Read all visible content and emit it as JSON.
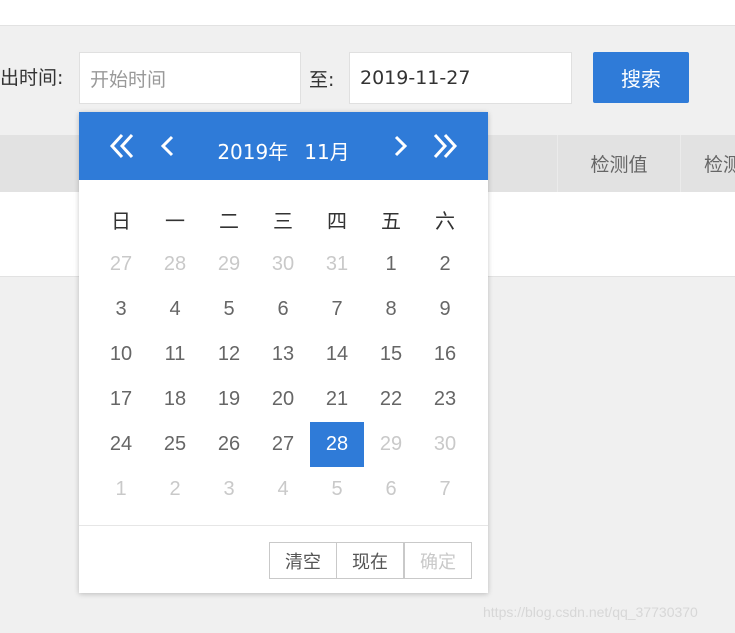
{
  "form": {
    "from_label": "出时间:",
    "start_placeholder": "开始时间",
    "to_label": "至:",
    "end_value": "2019-11-27",
    "search_label": "搜索"
  },
  "table": {
    "headers": [
      "检测值",
      "检测"
    ]
  },
  "datepicker": {
    "year": "2019年",
    "month": "11月",
    "weekdays": [
      "日",
      "一",
      "二",
      "三",
      "四",
      "五",
      "六"
    ],
    "days": [
      {
        "d": "27",
        "muted": true
      },
      {
        "d": "28",
        "muted": true
      },
      {
        "d": "29",
        "muted": true
      },
      {
        "d": "30",
        "muted": true
      },
      {
        "d": "31",
        "muted": true
      },
      {
        "d": "1"
      },
      {
        "d": "2"
      },
      {
        "d": "3"
      },
      {
        "d": "4"
      },
      {
        "d": "5"
      },
      {
        "d": "6"
      },
      {
        "d": "7"
      },
      {
        "d": "8"
      },
      {
        "d": "9"
      },
      {
        "d": "10"
      },
      {
        "d": "11"
      },
      {
        "d": "12"
      },
      {
        "d": "13"
      },
      {
        "d": "14"
      },
      {
        "d": "15"
      },
      {
        "d": "16"
      },
      {
        "d": "17"
      },
      {
        "d": "18"
      },
      {
        "d": "19"
      },
      {
        "d": "20"
      },
      {
        "d": "21"
      },
      {
        "d": "22"
      },
      {
        "d": "23"
      },
      {
        "d": "24"
      },
      {
        "d": "25"
      },
      {
        "d": "26"
      },
      {
        "d": "27"
      },
      {
        "d": "28",
        "selected": true
      },
      {
        "d": "29",
        "muted": true
      },
      {
        "d": "30",
        "muted": true
      },
      {
        "d": "1",
        "muted": true
      },
      {
        "d": "2",
        "muted": true
      },
      {
        "d": "3",
        "muted": true
      },
      {
        "d": "4",
        "muted": true
      },
      {
        "d": "5",
        "muted": true
      },
      {
        "d": "6",
        "muted": true
      },
      {
        "d": "7",
        "muted": true
      }
    ],
    "buttons": {
      "clear": "清空",
      "now": "现在",
      "confirm": "确定"
    },
    "accent_color": "#2f7bd8"
  },
  "watermark": "https://blog.csdn.net/qq_37730370"
}
